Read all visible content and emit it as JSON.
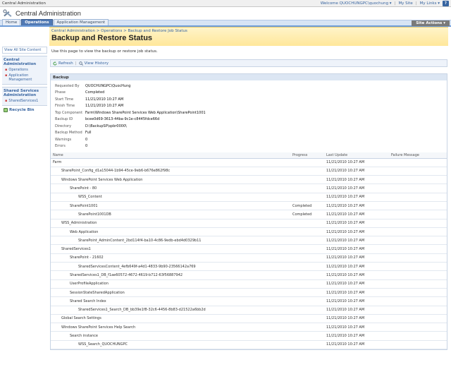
{
  "topbar": {
    "left": "Central Administration",
    "welcome": "Welcome QUOCHUNGPC\\quochung ▾",
    "my_site": "My Site",
    "my_links": "My Links ▾",
    "help": "?"
  },
  "header": {
    "title": "Central Administration"
  },
  "tabs": [
    "Home",
    "Operations",
    "Application Management"
  ],
  "site_actions": "Site Actions ▾",
  "leftnav": {
    "view_all": "View All Site Content",
    "groups": [
      {
        "heading": "Central Administration",
        "items": [
          "Operations",
          "Application Management"
        ]
      },
      {
        "heading": "Shared Services Administration",
        "items": [
          "SharedServices1"
        ]
      }
    ],
    "recycle_bin": "Recycle Bin"
  },
  "breadcrumb": "Central Administration > Operations > Backup and Restore Job Status",
  "page_title": "Backup and Restore Status",
  "description": "Use this page to view the backup or restore job status.",
  "toolbar": {
    "refresh": "Refresh",
    "separator": "|",
    "view_history": "View History"
  },
  "backup_section": {
    "heading": "Backup",
    "properties": [
      {
        "label": "Requested By",
        "value": "QUOCHUNGPC\\QuocHung"
      },
      {
        "label": "Phase",
        "value": "Completed"
      },
      {
        "label": "Start Time",
        "value": "11/21/2010 10:27 AM"
      },
      {
        "label": "Finish Time",
        "value": "11/21/2010 10:27 AM"
      },
      {
        "label": "Top Component",
        "value": "Farm\\Windows SharePoint Services Web Application\\SharePoint1001"
      },
      {
        "label": "Backup ID",
        "value": "bcee0d69-3613-44ba-9c1e-c8445fdce66d"
      },
      {
        "label": "Directory",
        "value": "D:\\BackupSP\\spbr0000\\"
      },
      {
        "label": "Backup Method",
        "value": "Full"
      },
      {
        "label": "Warnings",
        "value": "0"
      },
      {
        "label": "Errors",
        "value": "0"
      }
    ]
  },
  "table": {
    "columns": [
      "Name",
      "Progress",
      "Last Update",
      "Failure Message"
    ],
    "rows": [
      {
        "name": "Farm",
        "indent": 0,
        "progress": "",
        "last_update": "11/21/2010 10:27 AM",
        "failure": ""
      },
      {
        "name": "SharePoint_Config_d1a15044-1b94-45ce-9eb6-b676e862f98c",
        "indent": 1,
        "progress": "",
        "last_update": "11/21/2010 10:27 AM",
        "failure": ""
      },
      {
        "name": "Windows SharePoint Services Web Application",
        "indent": 1,
        "progress": "",
        "last_update": "11/21/2010 10:27 AM",
        "failure": ""
      },
      {
        "name": "SharePoint - 80",
        "indent": 2,
        "progress": "",
        "last_update": "11/21/2010 10:27 AM",
        "failure": ""
      },
      {
        "name": "WSS_Content",
        "indent": 3,
        "progress": "",
        "last_update": "11/21/2010 10:27 AM",
        "failure": ""
      },
      {
        "name": "SharePoint1001",
        "indent": 2,
        "progress": "Completed",
        "last_update": "11/21/2010 10:27 AM",
        "failure": ""
      },
      {
        "name": "SharePoint1001DB",
        "indent": 3,
        "progress": "Completed",
        "last_update": "11/21/2010 10:27 AM",
        "failure": ""
      },
      {
        "name": "WSS_Administration",
        "indent": 1,
        "progress": "",
        "last_update": "11/21/2010 10:27 AM",
        "failure": ""
      },
      {
        "name": "Web Application",
        "indent": 2,
        "progress": "",
        "last_update": "11/21/2010 10:27 AM",
        "failure": ""
      },
      {
        "name": "SharePoint_AdminContent_2bd114f4-ba10-4c86-9edb-ebd4d0329b11",
        "indent": 3,
        "progress": "",
        "last_update": "11/21/2010 10:27 AM",
        "failure": ""
      },
      {
        "name": "SharedServices1",
        "indent": 1,
        "progress": "",
        "last_update": "11/21/2010 10:27 AM",
        "failure": ""
      },
      {
        "name": "SharePoint - 21602",
        "indent": 2,
        "progress": "",
        "last_update": "11/21/2010 10:27 AM",
        "failure": ""
      },
      {
        "name": "SharedServicesContent_4efb649f-a4d1-4833-9b90-23566142a769",
        "indent": 3,
        "progress": "",
        "last_update": "11/21/2010 10:27 AM",
        "failure": ""
      },
      {
        "name": "SharedServices1_DB_f1ae60572-4672-4619-b712-63f56887942",
        "indent": 2,
        "progress": "",
        "last_update": "11/21/2010 10:27 AM",
        "failure": ""
      },
      {
        "name": "UserProfileApplication",
        "indent": 2,
        "progress": "",
        "last_update": "11/21/2010 10:27 AM",
        "failure": ""
      },
      {
        "name": "SessionStateSharedApplication",
        "indent": 2,
        "progress": "",
        "last_update": "11/21/2010 10:27 AM",
        "failure": ""
      },
      {
        "name": "Shared Search Index",
        "indent": 2,
        "progress": "",
        "last_update": "11/21/2010 10:27 AM",
        "failure": ""
      },
      {
        "name": "SharedServices1_Search_DB_bb39e1f8-32c6-4456-8b83-d21522a6bb2d",
        "indent": 3,
        "progress": "",
        "last_update": "11/21/2010 10:27 AM",
        "failure": ""
      },
      {
        "name": "Global Search Settings",
        "indent": 1,
        "progress": "",
        "last_update": "11/21/2010 10:27 AM",
        "failure": ""
      },
      {
        "name": "Windows SharePoint Services Help Search",
        "indent": 1,
        "progress": "",
        "last_update": "11/21/2010 10:27 AM",
        "failure": ""
      },
      {
        "name": "Search instance",
        "indent": 2,
        "progress": "",
        "last_update": "11/21/2010 10:27 AM",
        "failure": ""
      },
      {
        "name": "WSS_Search_QUOCHUNGPC",
        "indent": 3,
        "progress": "",
        "last_update": "11/21/2010 10:27 AM",
        "failure": ""
      }
    ]
  },
  "colors": {
    "accent": "#3764a0",
    "title_band": "#ffe79a",
    "tab_active": "#5079b4"
  }
}
